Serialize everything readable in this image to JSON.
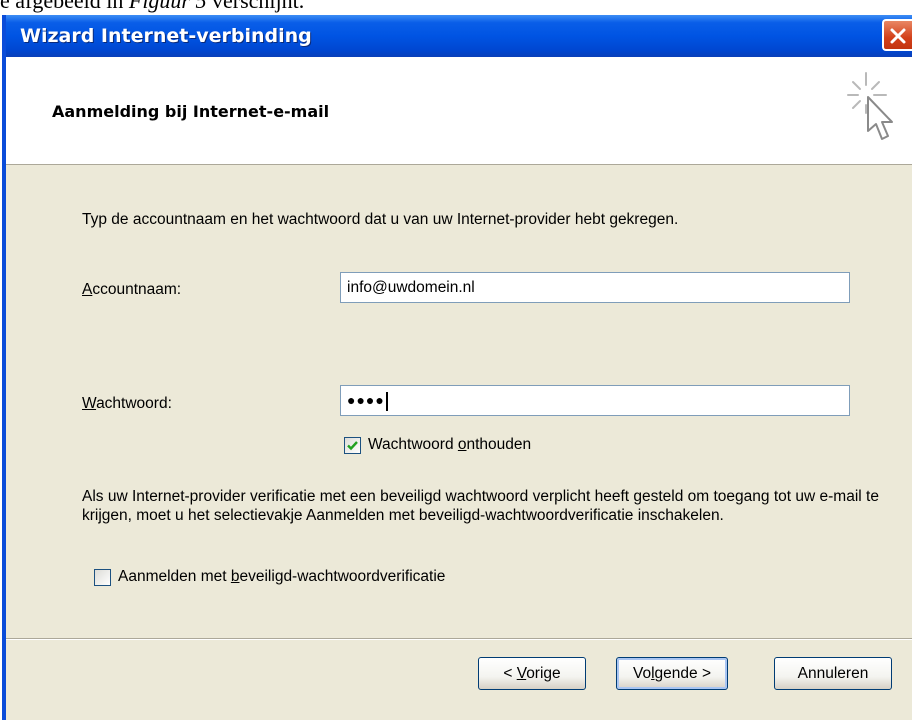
{
  "doc_caption": {
    "prefix": "e afgebeeld in ",
    "figure": "Figuur 5",
    "suffix": " verschijnt."
  },
  "window": {
    "title": "Wizard Internet-verbinding"
  },
  "header": {
    "title": "Aanmelding bij Internet-e-mail"
  },
  "body": {
    "intro": "Typ de accountnaam en het wachtwoord dat u van uw Internet-provider hebt gekregen.",
    "account": {
      "label_first": "A",
      "label_rest": "ccountnaam:",
      "value": "info@uwdomein.nl"
    },
    "password": {
      "label_first": "W",
      "label_rest": "achtwoord:",
      "value": "●●●●"
    },
    "remember": {
      "label_pre": "Wachtwoord ",
      "label_u": "o",
      "label_post": "nthouden",
      "checked": true
    },
    "spa_text": "Als uw Internet-provider verificatie met een beveiligd wachtwoord verplicht heeft gesteld om toegang tot uw e-mail te krijgen, moet u het selectievakje Aanmelden met beveiligd-wachtwoordverificatie inschakelen.",
    "spa": {
      "label_pre": "Aanmelden met ",
      "label_u": "b",
      "label_post": "eveiligd-wachtwoordverificatie",
      "checked": false
    }
  },
  "buttons": {
    "back": {
      "pre": "< ",
      "u": "V",
      "post": "orige"
    },
    "next": {
      "pre": "Vo",
      "u": "l",
      "post": "gende >"
    },
    "cancel": "Annuleren"
  },
  "colors": {
    "titlebar": "#0054e3",
    "dialog_bg": "#ece9d8",
    "close": "#d3401a",
    "check": "#21a121"
  }
}
